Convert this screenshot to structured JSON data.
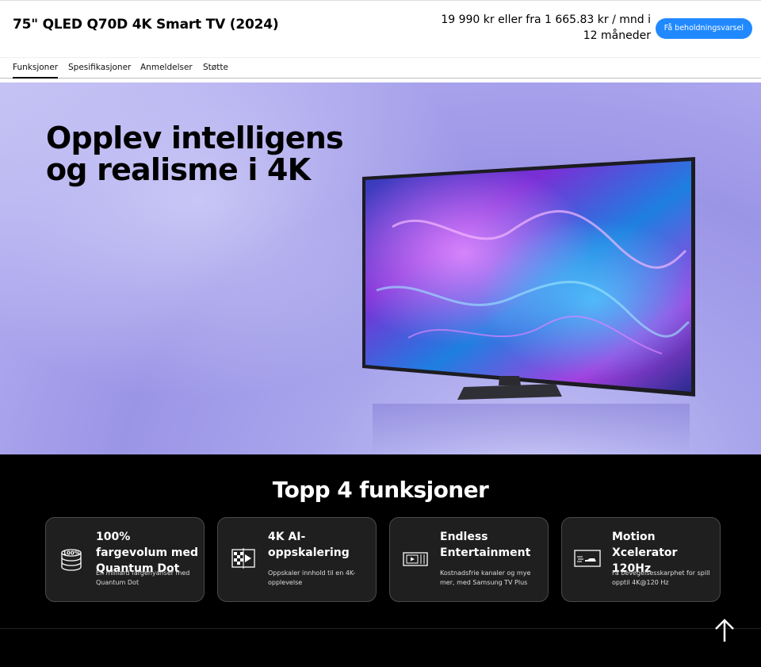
{
  "header": {
    "product_title": "75\" QLED Q70D 4K Smart TV (2024)",
    "price_text": "19 990 kr eller fra 1 665.83 kr / mnd i 12 måneder",
    "stock_button": "Få beholdningsvarsel"
  },
  "tabs": [
    {
      "label": "Funksjoner",
      "active": true
    },
    {
      "label": "Spesifikasjoner",
      "active": false
    },
    {
      "label": "Anmeldelser",
      "active": false
    },
    {
      "label": "Støtte",
      "active": false
    }
  ],
  "hero": {
    "headline": "Opplev intelligens og realisme i 4K"
  },
  "features": {
    "title": "Topp 4 funksjoner",
    "cards": [
      {
        "title": "100% fargevolum med Quantum Dot",
        "desc": "En milliard fargenyanser med Quantum Dot",
        "icon": "quantum-dot-100-icon",
        "icon_text": "100%"
      },
      {
        "title": "4K AI-oppskalering",
        "desc": "Oppskaler innhold til en 4K-opplevelse",
        "icon": "ai-upscaling-icon"
      },
      {
        "title": "Endless Entertainment",
        "desc": "Kostnadsfrie kanaler og mye mer, med Samsung TV Plus",
        "icon": "tv-plus-icon"
      },
      {
        "title": "Motion Xcelerator 120Hz",
        "desc": "Få bevegelsesskarphet for spill opptil 4K@120 Hz",
        "icon": "motion-xcelerator-icon"
      }
    ]
  },
  "colors": {
    "accent": "#2189ff",
    "hero_bg": "#a8a5ec",
    "card_bg": "#1f1f1f"
  }
}
